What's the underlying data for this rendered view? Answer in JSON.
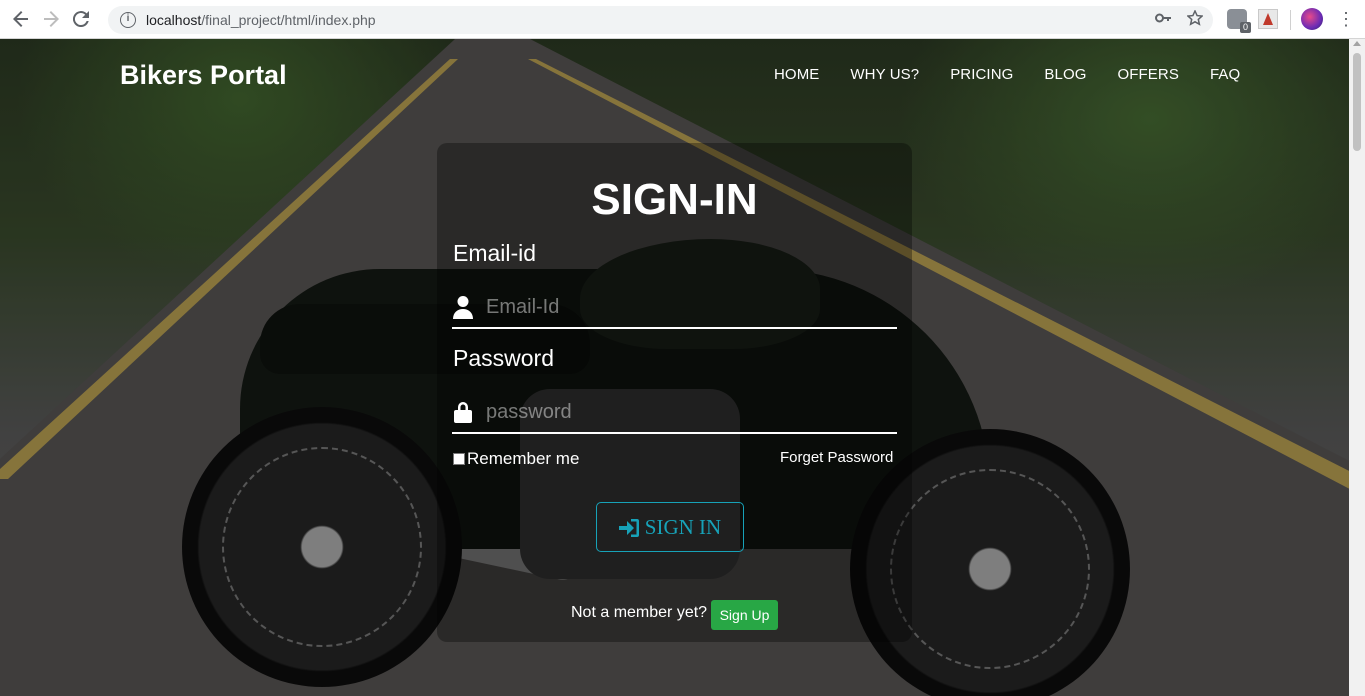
{
  "browser": {
    "url_host": "localhost",
    "url_path": "/final_project/html/index.php",
    "extension_badge": "0"
  },
  "nav": {
    "brand": "Bikers Portal",
    "items": [
      "HOME",
      "WHY US?",
      "PRICING",
      "BLOG",
      "OFFERS",
      "FAQ"
    ]
  },
  "signin": {
    "title": "SIGN-IN",
    "email_label": "Email-id",
    "email_placeholder": "Email-Id",
    "email_value": "",
    "password_label": "Password",
    "password_placeholder": "password",
    "password_value": "",
    "remember_label": "Remember me",
    "remember_checked": false,
    "forgot_label": "Forget Password",
    "submit_label": "SIGN IN",
    "not_member_text": "Not a member yet?",
    "signup_label": "Sign Up"
  },
  "colors": {
    "accent": "#17a2b8",
    "signup": "#28a745",
    "card_bg": "rgba(0,0,0,0.32)"
  },
  "icons": [
    "back-icon",
    "forward-icon",
    "reload-icon",
    "info-icon",
    "key-icon",
    "star-icon",
    "user-icon",
    "lock-icon",
    "sign-in-icon"
  ]
}
